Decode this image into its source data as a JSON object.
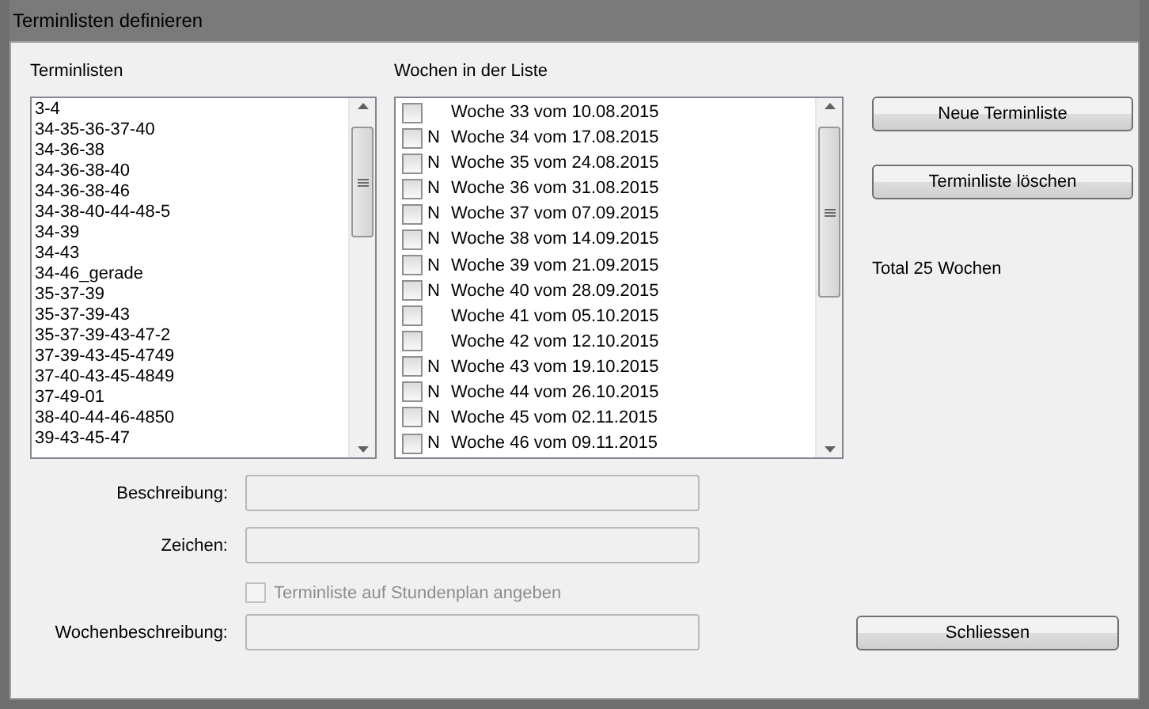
{
  "window": {
    "title": "Terminlisten definieren"
  },
  "lists": {
    "label": "Terminlisten",
    "items": [
      {
        "text": "3-4",
        "selected": false
      },
      {
        "text": "34-35-36-37-40",
        "selected": false
      },
      {
        "text": "34-36-38",
        "selected": false
      },
      {
        "text": "34-36-38-40",
        "selected": false
      },
      {
        "text": "34-36-38-46",
        "selected": false
      },
      {
        "text": "34-38-40-44-48-5",
        "selected": false
      },
      {
        "text": "34-39",
        "selected": false
      },
      {
        "text": "34-43",
        "selected": false
      },
      {
        "text": "34-46_gerade",
        "selected": false
      },
      {
        "text": "35-37-39",
        "selected": false
      },
      {
        "text": "35-37-39-43",
        "selected": false
      },
      {
        "text": "35-37-39-43-47-2",
        "selected": false
      },
      {
        "text": "37-39-43-45-4749",
        "selected": false
      },
      {
        "text": "37-40-43-45-4849",
        "selected": false
      },
      {
        "text": "37-49-01",
        "selected": false
      },
      {
        "text": "38-40-44-46-4850",
        "selected": false
      },
      {
        "text": "39-43-45-47",
        "selected": false
      }
    ]
  },
  "weeks": {
    "label": "Wochen in der Liste",
    "items": [
      {
        "checked": false,
        "text": "Woche 33 vom 10.08.2015"
      },
      {
        "checked": false,
        "marker": "N",
        "text": "Woche 34 vom 17.08.2015"
      },
      {
        "checked": false,
        "marker": "N",
        "text": "Woche 35 vom 24.08.2015"
      },
      {
        "checked": false,
        "marker": "N",
        "text": "Woche 36 vom 31.08.2015"
      },
      {
        "checked": false,
        "marker": "N",
        "text": "Woche 37 vom 07.09.2015"
      },
      {
        "checked": false,
        "marker": "N",
        "text": "Woche 38 vom 14.09.2015"
      },
      {
        "checked": false,
        "marker": "N",
        "text": "Woche 39 vom 21.09.2015"
      },
      {
        "checked": false,
        "marker": "N",
        "text": "Woche 40 vom 28.09.2015"
      },
      {
        "checked": false,
        "text": "Woche 41 vom 05.10.2015"
      },
      {
        "checked": false,
        "text": "Woche 42 vom 12.10.2015"
      },
      {
        "checked": false,
        "marker": "N",
        "text": "Woche 43 vom 19.10.2015"
      },
      {
        "checked": false,
        "marker": "N",
        "text": "Woche 44 vom 26.10.2015"
      },
      {
        "checked": false,
        "marker": "N",
        "text": "Woche 45 vom 02.11.2015"
      },
      {
        "checked": false,
        "marker": "N",
        "text": "Woche 46 vom 09.11.2015"
      }
    ]
  },
  "buttons": [
    {
      "label": "Neue Terminliste"
    },
    {
      "label": "Terminliste löschen"
    }
  ],
  "total": "Total 25 Wochen",
  "fields": [
    {
      "label": "Beschreibung:",
      "disabled": true
    },
    {
      "label": "Zeichen:",
      "disabled": true
    }
  ],
  "option": {
    "label": "Terminliste auf Stundenplan angeben",
    "checked": false,
    "disabled": true
  },
  "week_field": {
    "label": "Wochenbeschreibung:",
    "disabled": true
  },
  "close_button": {
    "label": "Schliessen"
  }
}
